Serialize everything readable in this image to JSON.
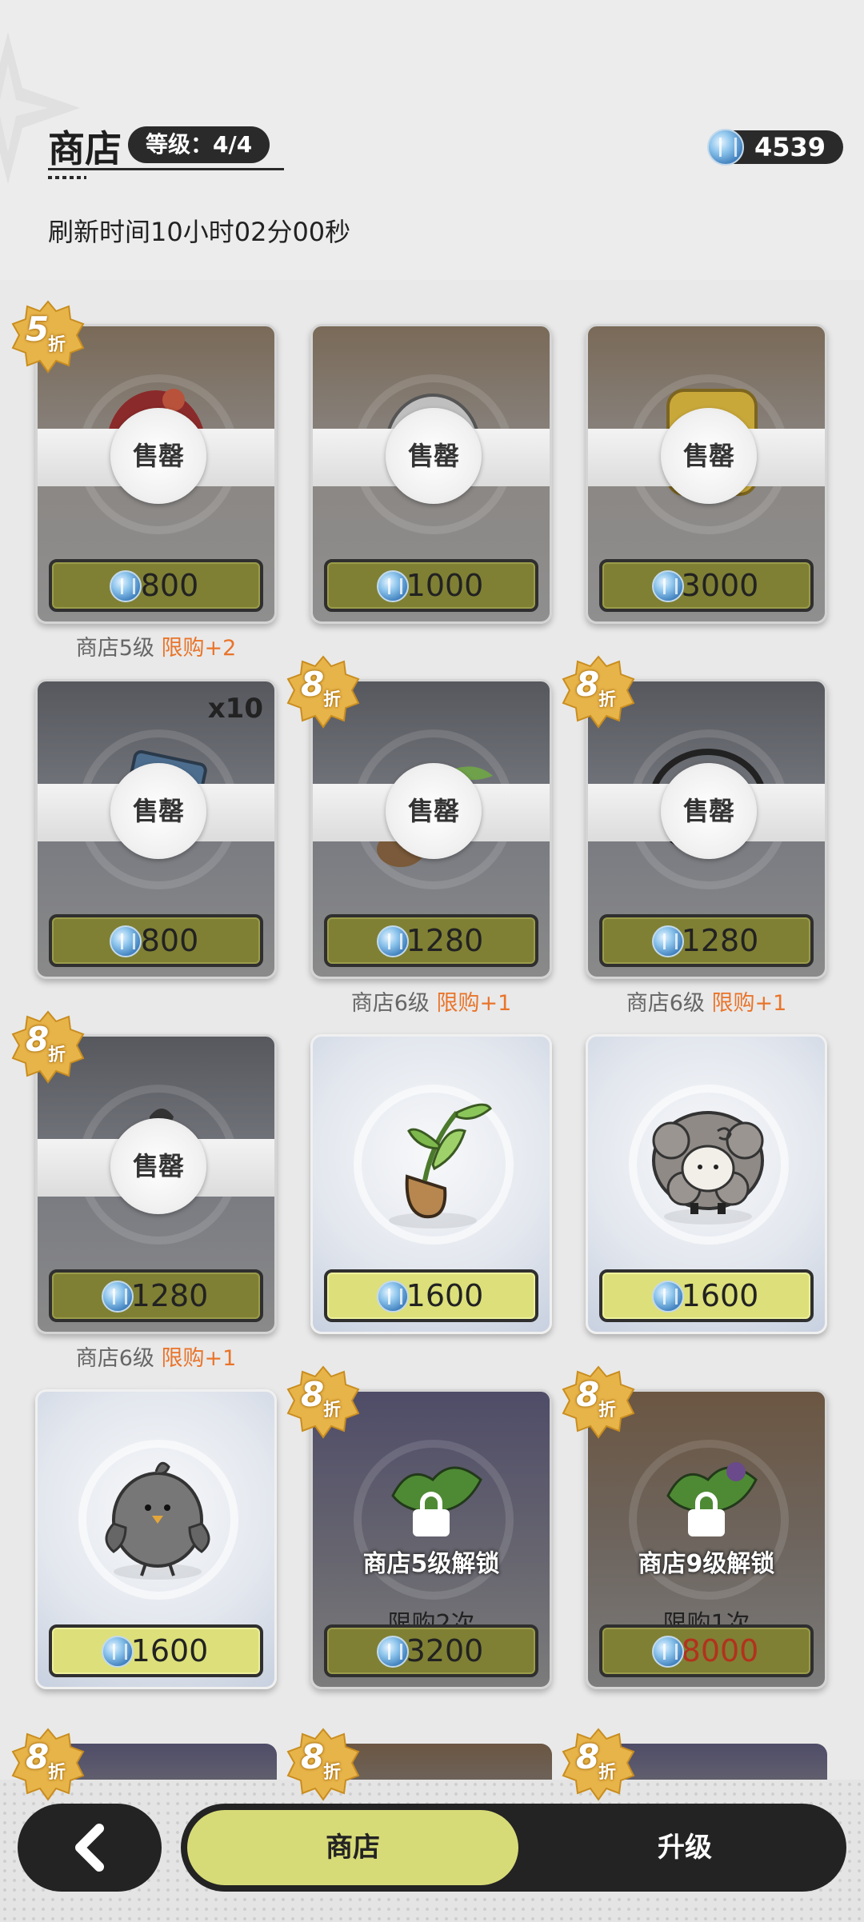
{
  "header": {
    "title": "商店",
    "level_label": "等级：4/4",
    "currency_amount": "4539",
    "refresh_text": "刷新时间10小时02分00秒"
  },
  "sold_label": "售罄",
  "items": [
    {
      "state": "sold",
      "price": "800",
      "discount": "5",
      "discount_unit": "折",
      "below_prefix": "商店5级",
      "below_limit": "限购+2"
    },
    {
      "state": "sold",
      "price": "1000"
    },
    {
      "state": "sold",
      "price": "3000"
    },
    {
      "state": "sold",
      "price": "800",
      "quantity": "x10"
    },
    {
      "state": "sold",
      "price": "1280",
      "discount": "8",
      "discount_unit": "折",
      "below_prefix": "商店6级",
      "below_limit": "限购+1"
    },
    {
      "state": "sold",
      "price": "1280",
      "discount": "8",
      "discount_unit": "折",
      "below_prefix": "商店6级",
      "below_limit": "限购+1"
    },
    {
      "state": "sold",
      "price": "1280",
      "discount": "8",
      "discount_unit": "折",
      "below_prefix": "商店6级",
      "below_limit": "限购+1"
    },
    {
      "state": "available",
      "price": "1600",
      "icon": "sprout-pot-icon"
    },
    {
      "state": "available",
      "price": "1600",
      "icon": "sheep-icon"
    },
    {
      "state": "available",
      "price": "1600",
      "icon": "gray-bird-icon"
    },
    {
      "state": "locked",
      "price": "3200",
      "discount": "8",
      "discount_unit": "折",
      "lock_text": "商店5级解锁",
      "limit_text": "限购2次"
    },
    {
      "state": "locked",
      "price": "8000",
      "price_color": "#b2321d",
      "discount": "8",
      "discount_unit": "折",
      "lock_text": "商店9级解锁",
      "limit_text": "限购1次"
    }
  ],
  "partial_row_discounts": [
    "8",
    "8",
    "8"
  ],
  "partial_row_discount_unit": "折",
  "bottom_nav": {
    "back_icon": "back-arrow-icon",
    "tab_shop": "商店",
    "tab_upgrade": "升级"
  },
  "colors": {
    "price_bar_dark": "#7f8034",
    "price_bar_bright": "#dde07a",
    "limit_highlight": "#e9742a",
    "tab_active": "#d7db77"
  }
}
